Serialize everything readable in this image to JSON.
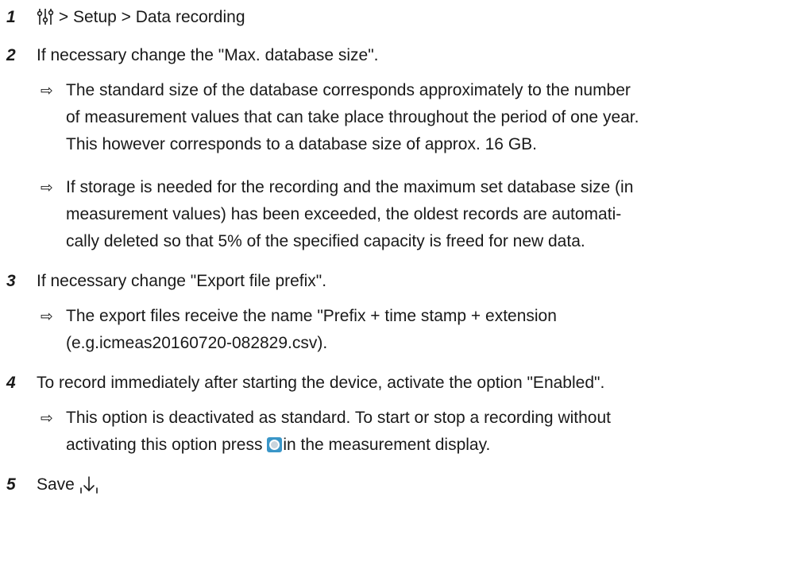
{
  "steps": [
    {
      "num": "1",
      "text": "> Setup > Data recording"
    },
    {
      "num": "2",
      "text": "If necessary change the \"Max. database size\"."
    },
    {
      "num": "3",
      "text": "If necessary change \"Export file prefix\"."
    },
    {
      "num": "4",
      "text": "To record immediately after starting the device, activate the option \"Enabled\"."
    },
    {
      "num": "5",
      "text": "Save"
    }
  ],
  "results": {
    "r2a": [
      "The standard size of the database corresponds approximately to the number",
      "of measurement values that can take place throughout the period of one year.",
      "This however corresponds to a database size of approx. 16 GB."
    ],
    "r2b": [
      "If storage is needed for the recording and the maximum set database size (in",
      "measurement values) has been exceeded, the oldest records are automati-",
      "cally deleted so that 5% of the specified capacity is freed for new data."
    ],
    "r3": [
      "The export files receive the name \"Prefix + time stamp + extension",
      "(e.g.icmeas20160720-082829.csv)."
    ],
    "r4": [
      "This option is deactivated as standard. To start or stop a recording without",
      "activating this option press",
      "in the measurement display."
    ]
  },
  "arrow_glyph": "⇨",
  "icons": {
    "settings": "settings-sliders-icon",
    "record": "record-button-icon",
    "save": "save-arrow-icon",
    "record_color": "#3a96c8"
  }
}
